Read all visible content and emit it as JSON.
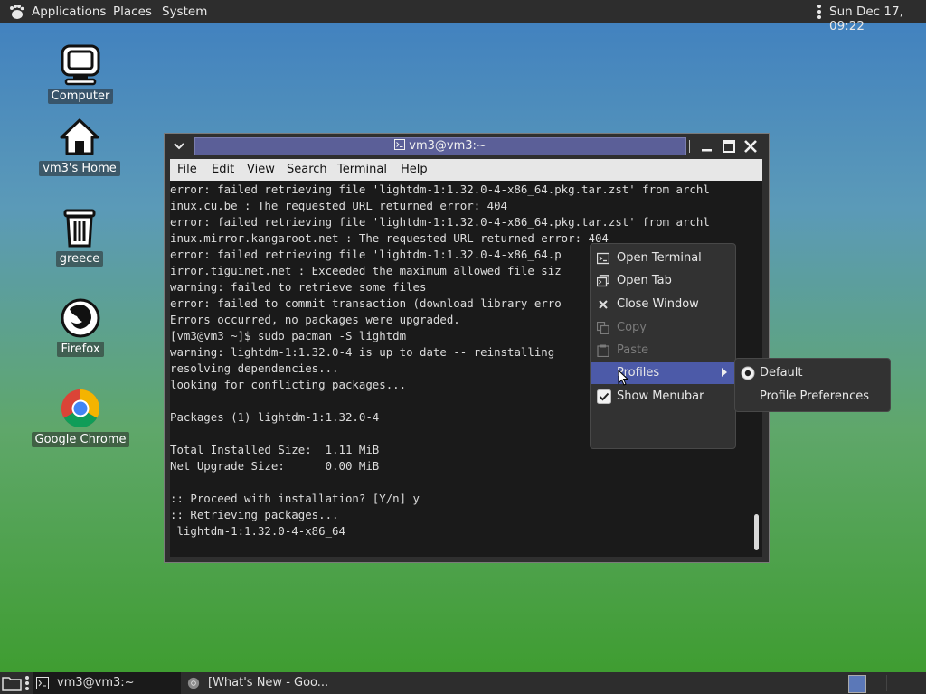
{
  "top_panel": {
    "applications": "Applications",
    "places": "Places",
    "system": "System",
    "clock": "Sun Dec 17, 09:22"
  },
  "desktop_icons": [
    {
      "label": "Computer",
      "icon": "computer-icon"
    },
    {
      "label": "vm3's Home",
      "icon": "home-icon"
    },
    {
      "label": "greece",
      "icon": "trash-icon"
    },
    {
      "label": "Firefox",
      "icon": "firefox-icon"
    },
    {
      "label": "Google Chrome",
      "icon": "chrome-icon"
    }
  ],
  "terminal": {
    "title": "vm3@vm3:~",
    "menu": [
      "File",
      "Edit",
      "View",
      "Search",
      "Terminal",
      "Help"
    ],
    "lines": [
      "error: failed retrieving file 'lightdm-1:1.32.0-4-x86_64.pkg.tar.zst' from archl",
      "inux.cu.be : The requested URL returned error: 404",
      "error: failed retrieving file 'lightdm-1:1.32.0-4-x86_64.pkg.tar.zst' from archl",
      "inux.mirror.kangaroot.net : The requested URL returned error: 404",
      "error: failed retrieving file 'lightdm-1:1.32.0-4-x86_64.p                      m",
      "irror.tiguinet.net : Exceeded the maximum allowed file siz",
      "warning: failed to retrieve some files",
      "error: failed to commit transaction (download library erro",
      "Errors occurred, no packages were upgraded.",
      "[vm3@vm3 ~]$ sudo pacman -S lightdm",
      "warning: lightdm-1:1.32.0-4 is up to date -- reinstalling",
      "resolving dependencies...",
      "looking for conflicting packages...",
      "",
      "Packages (1) lightdm-1:1.32.0-4",
      "",
      "Total Installed Size:  1.11 MiB",
      "Net Upgrade Size:      0.00 MiB",
      "",
      ":: Proceed with installation? [Y/n] y",
      ":: Retrieving packages...",
      " lightdm-1:1.32.0-4-x86_64"
    ]
  },
  "context_menu": {
    "items": [
      {
        "label": "Open Terminal",
        "icon": "terminal-icon",
        "enabled": true
      },
      {
        "label": "Open Tab",
        "icon": "tab-icon",
        "enabled": true
      },
      {
        "label": "Close Window",
        "icon": "close-icon",
        "enabled": true
      },
      {
        "label": "Copy",
        "icon": "copy-icon",
        "enabled": false
      },
      {
        "label": "Paste",
        "icon": "paste-icon",
        "enabled": false
      },
      {
        "label": "Profiles",
        "icon": "",
        "enabled": true,
        "highlighted": true
      },
      {
        "label": "Show Menubar",
        "icon": "checkbox-checked-icon",
        "enabled": true
      }
    ]
  },
  "profiles_submenu": {
    "items": [
      {
        "label": "Default",
        "selected": true
      },
      {
        "label": "Profile Preferences",
        "selected": false
      }
    ]
  },
  "taskbar": {
    "items": [
      {
        "label": "vm3@vm3:~",
        "icon": "terminal-icon"
      },
      {
        "label": "[What's New - Goo...",
        "icon": "chrome-icon"
      }
    ]
  },
  "colors": {
    "highlight": "#4c5aa8",
    "title_bar_active": "#5b5f98",
    "terminal_bg": "#1a1a1a"
  }
}
